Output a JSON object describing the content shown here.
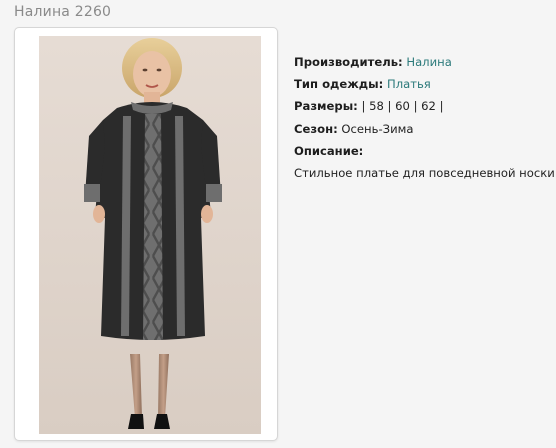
{
  "product": {
    "title": "Налина 2260"
  },
  "details": {
    "manufacturer_label": "Производитель:",
    "manufacturer_value": "Налина",
    "type_label": "Тип одежды:",
    "type_value": "Платья",
    "sizes_label": "Размеры:",
    "sizes_value": "| 58 | 60 | 62 |",
    "season_label": "Сезон:",
    "season_value": "Осень-Зима",
    "description_label": "Описание:",
    "description_value": "Стильное платье для повседневной носки."
  },
  "image": {
    "icon": "dress-photo"
  },
  "colors": {
    "title": "#8a8a8a",
    "link": "#2c7a7b",
    "background": "#f5f5f5",
    "dress_dark": "#2b2b2b",
    "dress_gray": "#6e6e6e"
  }
}
